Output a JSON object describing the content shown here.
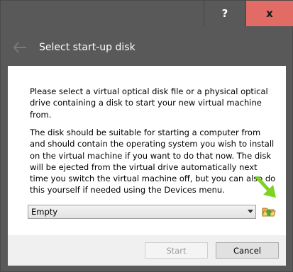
{
  "titlebar": {
    "help_label": "?",
    "close_label": "x"
  },
  "wizard": {
    "title": "Select start-up disk"
  },
  "content": {
    "paragraph1": "Please select a virtual optical disk file or a physical optical drive containing a disk to start your new virtual machine from.",
    "paragraph2": "The disk should be suitable for starting a computer from and should contain the operating system you wish to install on the virtual machine if you want to do that now. The disk will be ejected from the virtual drive automatically next time you switch the virtual machine off, but you can also do this yourself if needed using the Devices menu.",
    "disk_select": {
      "value": "Empty"
    }
  },
  "buttons": {
    "start": "Start",
    "cancel": "Cancel"
  },
  "colors": {
    "titlebar_bg": "#595959",
    "close_bg": "#e26b66",
    "content_bg": "#ffffff",
    "footer_bg": "#f0f0f0",
    "arrow_green": "#7ed321"
  },
  "icons": {
    "back": "back-arrow-icon",
    "folder": "folder-open-icon",
    "pointer": "green-pointer-arrow-icon",
    "dropdown": "chevron-down-icon"
  }
}
